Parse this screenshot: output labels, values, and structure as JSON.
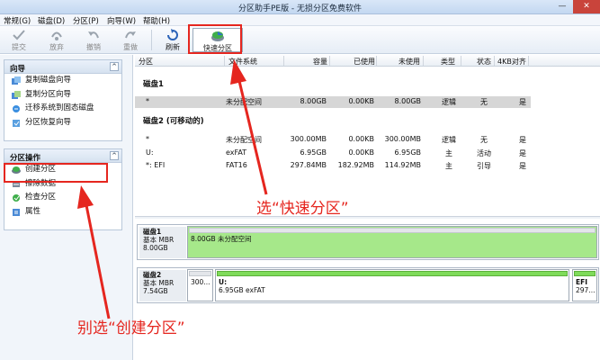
{
  "window": {
    "title": "分区助手PE版 - 无损分区免费软件",
    "controls": {
      "minimize": "—",
      "close": "✕"
    }
  },
  "menu": [
    "常规(G)",
    "磁盘(D)",
    "分区(P)",
    "向导(W)",
    "帮助(H)"
  ],
  "toolbar": {
    "commit": "提交",
    "discard": "放弃",
    "undo": "撤销",
    "redo": "重做",
    "refresh": "刷新",
    "quick_partition": "快速分区"
  },
  "sidebar": {
    "wizard": {
      "title": "向导",
      "items": [
        "复制磁盘向导",
        "复制分区向导",
        "迁移系统到固态磁盘",
        "分区恢复向导"
      ]
    },
    "partition_ops": {
      "title": "分区操作",
      "items": [
        "创建分区",
        "擦除数据",
        "检查分区",
        "属性"
      ]
    },
    "collapse_glyph": "^"
  },
  "table": {
    "headers": [
      "分区",
      "文件系统",
      "容量",
      "已使用",
      "未使用",
      "类型",
      "状态",
      "4KB对齐"
    ],
    "disk1": {
      "label": "磁盘1",
      "rows": [
        [
          "*",
          "未分配空间",
          "8.00GB",
          "0.00KB",
          "8.00GB",
          "逻辑",
          "无",
          "是"
        ]
      ]
    },
    "disk2": {
      "label": "磁盘2 (可移动的)",
      "rows": [
        [
          "*",
          "未分配空间",
          "300.00MB",
          "0.00KB",
          "300.00MB",
          "逻辑",
          "无",
          "是"
        ],
        [
          "U:",
          "exFAT",
          "6.95GB",
          "0.00KB",
          "6.95GB",
          "主",
          "活动",
          "是"
        ],
        [
          "*: EFI",
          "FAT16",
          "297.84MB",
          "182.92MB",
          "114.92MB",
          "主",
          "引导",
          "是"
        ]
      ]
    }
  },
  "diskmap": {
    "disk1": {
      "name": "磁盘1",
      "type": "基本 MBR",
      "size": "8.00GB",
      "partitions": [
        {
          "label": "",
          "detail": "8.00GB 未分配空间"
        }
      ]
    },
    "disk2": {
      "name": "磁盘2",
      "type": "基本 MBR",
      "size": "7.54GB",
      "partitions": [
        {
          "label": "",
          "detail": "300..."
        },
        {
          "label": "U:",
          "detail": "6.95GB exFAT"
        },
        {
          "label": "EFI",
          "detail": "297..."
        }
      ]
    }
  },
  "annotations": {
    "quick_hint": "选“快速分区”",
    "create_hint": "别选“创建分区”",
    "color": "#e5261f"
  }
}
